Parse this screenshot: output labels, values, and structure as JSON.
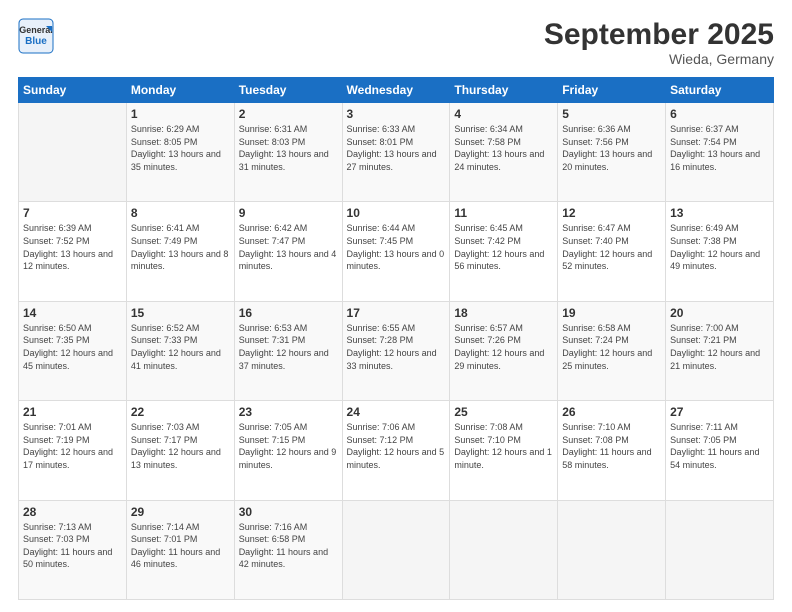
{
  "header": {
    "logo_general": "General",
    "logo_blue": "Blue",
    "title": "September 2025",
    "subtitle": "Wieda, Germany"
  },
  "days_of_week": [
    "Sunday",
    "Monday",
    "Tuesday",
    "Wednesday",
    "Thursday",
    "Friday",
    "Saturday"
  ],
  "weeks": [
    [
      {
        "num": "",
        "sunrise": "",
        "sunset": "",
        "daylight": ""
      },
      {
        "num": "1",
        "sunrise": "Sunrise: 6:29 AM",
        "sunset": "Sunset: 8:05 PM",
        "daylight": "Daylight: 13 hours and 35 minutes."
      },
      {
        "num": "2",
        "sunrise": "Sunrise: 6:31 AM",
        "sunset": "Sunset: 8:03 PM",
        "daylight": "Daylight: 13 hours and 31 minutes."
      },
      {
        "num": "3",
        "sunrise": "Sunrise: 6:33 AM",
        "sunset": "Sunset: 8:01 PM",
        "daylight": "Daylight: 13 hours and 27 minutes."
      },
      {
        "num": "4",
        "sunrise": "Sunrise: 6:34 AM",
        "sunset": "Sunset: 7:58 PM",
        "daylight": "Daylight: 13 hours and 24 minutes."
      },
      {
        "num": "5",
        "sunrise": "Sunrise: 6:36 AM",
        "sunset": "Sunset: 7:56 PM",
        "daylight": "Daylight: 13 hours and 20 minutes."
      },
      {
        "num": "6",
        "sunrise": "Sunrise: 6:37 AM",
        "sunset": "Sunset: 7:54 PM",
        "daylight": "Daylight: 13 hours and 16 minutes."
      }
    ],
    [
      {
        "num": "7",
        "sunrise": "Sunrise: 6:39 AM",
        "sunset": "Sunset: 7:52 PM",
        "daylight": "Daylight: 13 hours and 12 minutes."
      },
      {
        "num": "8",
        "sunrise": "Sunrise: 6:41 AM",
        "sunset": "Sunset: 7:49 PM",
        "daylight": "Daylight: 13 hours and 8 minutes."
      },
      {
        "num": "9",
        "sunrise": "Sunrise: 6:42 AM",
        "sunset": "Sunset: 7:47 PM",
        "daylight": "Daylight: 13 hours and 4 minutes."
      },
      {
        "num": "10",
        "sunrise": "Sunrise: 6:44 AM",
        "sunset": "Sunset: 7:45 PM",
        "daylight": "Daylight: 13 hours and 0 minutes."
      },
      {
        "num": "11",
        "sunrise": "Sunrise: 6:45 AM",
        "sunset": "Sunset: 7:42 PM",
        "daylight": "Daylight: 12 hours and 56 minutes."
      },
      {
        "num": "12",
        "sunrise": "Sunrise: 6:47 AM",
        "sunset": "Sunset: 7:40 PM",
        "daylight": "Daylight: 12 hours and 52 minutes."
      },
      {
        "num": "13",
        "sunrise": "Sunrise: 6:49 AM",
        "sunset": "Sunset: 7:38 PM",
        "daylight": "Daylight: 12 hours and 49 minutes."
      }
    ],
    [
      {
        "num": "14",
        "sunrise": "Sunrise: 6:50 AM",
        "sunset": "Sunset: 7:35 PM",
        "daylight": "Daylight: 12 hours and 45 minutes."
      },
      {
        "num": "15",
        "sunrise": "Sunrise: 6:52 AM",
        "sunset": "Sunset: 7:33 PM",
        "daylight": "Daylight: 12 hours and 41 minutes."
      },
      {
        "num": "16",
        "sunrise": "Sunrise: 6:53 AM",
        "sunset": "Sunset: 7:31 PM",
        "daylight": "Daylight: 12 hours and 37 minutes."
      },
      {
        "num": "17",
        "sunrise": "Sunrise: 6:55 AM",
        "sunset": "Sunset: 7:28 PM",
        "daylight": "Daylight: 12 hours and 33 minutes."
      },
      {
        "num": "18",
        "sunrise": "Sunrise: 6:57 AM",
        "sunset": "Sunset: 7:26 PM",
        "daylight": "Daylight: 12 hours and 29 minutes."
      },
      {
        "num": "19",
        "sunrise": "Sunrise: 6:58 AM",
        "sunset": "Sunset: 7:24 PM",
        "daylight": "Daylight: 12 hours and 25 minutes."
      },
      {
        "num": "20",
        "sunrise": "Sunrise: 7:00 AM",
        "sunset": "Sunset: 7:21 PM",
        "daylight": "Daylight: 12 hours and 21 minutes."
      }
    ],
    [
      {
        "num": "21",
        "sunrise": "Sunrise: 7:01 AM",
        "sunset": "Sunset: 7:19 PM",
        "daylight": "Daylight: 12 hours and 17 minutes."
      },
      {
        "num": "22",
        "sunrise": "Sunrise: 7:03 AM",
        "sunset": "Sunset: 7:17 PM",
        "daylight": "Daylight: 12 hours and 13 minutes."
      },
      {
        "num": "23",
        "sunrise": "Sunrise: 7:05 AM",
        "sunset": "Sunset: 7:15 PM",
        "daylight": "Daylight: 12 hours and 9 minutes."
      },
      {
        "num": "24",
        "sunrise": "Sunrise: 7:06 AM",
        "sunset": "Sunset: 7:12 PM",
        "daylight": "Daylight: 12 hours and 5 minutes."
      },
      {
        "num": "25",
        "sunrise": "Sunrise: 7:08 AM",
        "sunset": "Sunset: 7:10 PM",
        "daylight": "Daylight: 12 hours and 1 minute."
      },
      {
        "num": "26",
        "sunrise": "Sunrise: 7:10 AM",
        "sunset": "Sunset: 7:08 PM",
        "daylight": "Daylight: 11 hours and 58 minutes."
      },
      {
        "num": "27",
        "sunrise": "Sunrise: 7:11 AM",
        "sunset": "Sunset: 7:05 PM",
        "daylight": "Daylight: 11 hours and 54 minutes."
      }
    ],
    [
      {
        "num": "28",
        "sunrise": "Sunrise: 7:13 AM",
        "sunset": "Sunset: 7:03 PM",
        "daylight": "Daylight: 11 hours and 50 minutes."
      },
      {
        "num": "29",
        "sunrise": "Sunrise: 7:14 AM",
        "sunset": "Sunset: 7:01 PM",
        "daylight": "Daylight: 11 hours and 46 minutes."
      },
      {
        "num": "30",
        "sunrise": "Sunrise: 7:16 AM",
        "sunset": "Sunset: 6:58 PM",
        "daylight": "Daylight: 11 hours and 42 minutes."
      },
      {
        "num": "",
        "sunrise": "",
        "sunset": "",
        "daylight": ""
      },
      {
        "num": "",
        "sunrise": "",
        "sunset": "",
        "daylight": ""
      },
      {
        "num": "",
        "sunrise": "",
        "sunset": "",
        "daylight": ""
      },
      {
        "num": "",
        "sunrise": "",
        "sunset": "",
        "daylight": ""
      }
    ]
  ]
}
